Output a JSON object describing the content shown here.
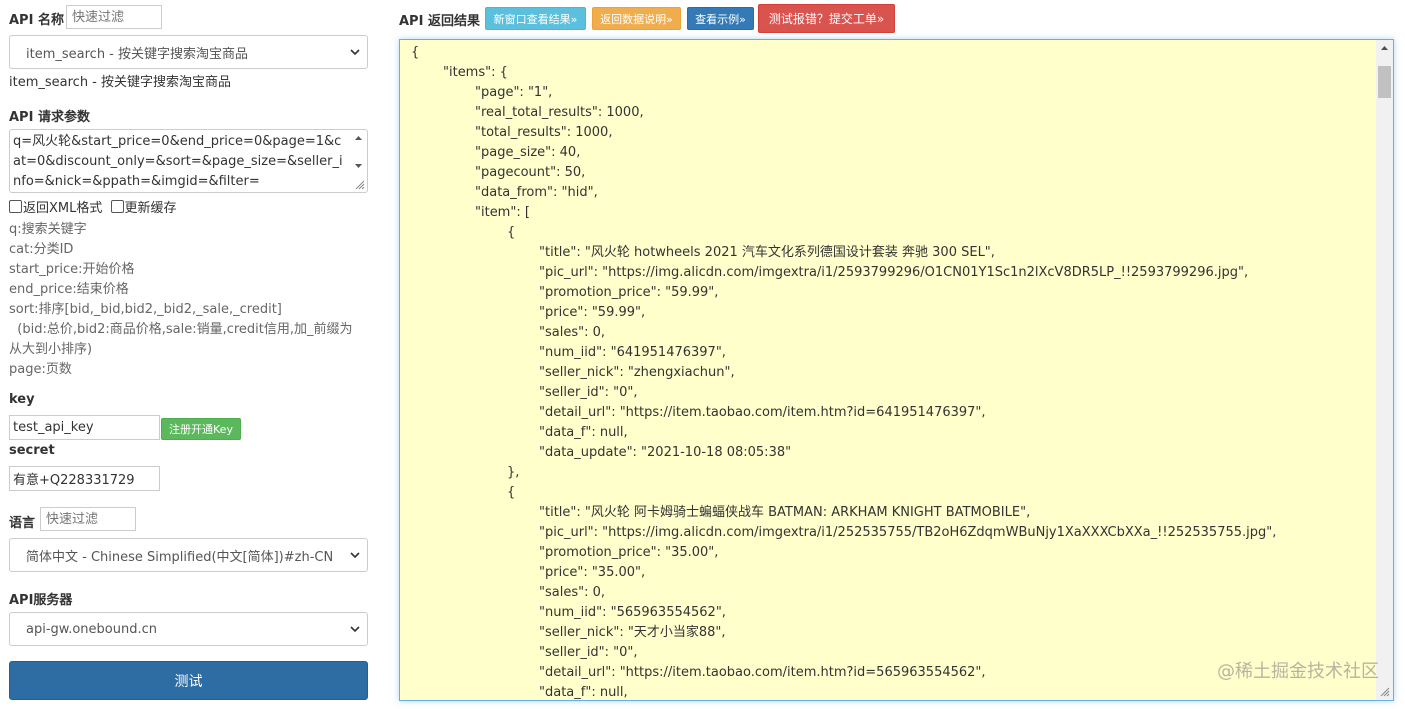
{
  "left": {
    "api_name_label": "API 名称",
    "api_name_filter_placeholder": "快速过滤",
    "api_select_value": "item_search - 按关键字搜索淘宝商品",
    "api_select_caption": "item_search - 按关键字搜索淘宝商品",
    "params_label": "API 请求参数",
    "params_value": "q=风火轮&start_price=0&end_price=0&page=1&cat=0&discount_only=&sort=&page_size=&seller_info=&nick=&ppath=&imgid=&filter=",
    "xml_checkbox_label": "返回XML格式",
    "cache_checkbox_label": "更新缓存",
    "hints": [
      "q:搜索关键字",
      "cat:分类ID",
      "start_price:开始价格",
      "end_price:结束价格",
      "sort:排序[bid,_bid,bid2,_bid2,_sale,_credit]",
      "  (bid:总价,bid2:商品价格,sale:销量,credit信用,加_前缀为",
      "从大到小排序)",
      "page:页数"
    ],
    "key_label": "key",
    "key_value": "test_api_key",
    "register_button": "注册开通Key",
    "secret_label": "secret",
    "secret_value": "有意+Q228331729",
    "lang_label": "语言",
    "lang_filter_placeholder": "快速过滤",
    "lang_select_value": "简体中文 - Chinese Simplified(中文[简体])#zh-CN",
    "server_label": "API服务器",
    "server_select_value": "api-gw.onebound.cn",
    "test_button": "测试"
  },
  "right": {
    "result_label": "API 返回结果",
    "buttons": [
      {
        "label": "新窗口查看结果»",
        "color": "#5bc0de"
      },
      {
        "label": "返回数据说明»",
        "color": "#f0ad4e"
      },
      {
        "label": "查看示例»",
        "color": "#337ab7"
      },
      {
        "label": "测试报错？提交工单»",
        "color": "#d9534f"
      }
    ],
    "json_lines": [
      "{",
      "\t\"items\": {",
      "\t\t\"page\": \"1\",",
      "\t\t\"real_total_results\": 1000,",
      "\t\t\"total_results\": 1000,",
      "\t\t\"page_size\": 40,",
      "\t\t\"pagecount\": 50,",
      "\t\t\"data_from\": \"hid\",",
      "\t\t\"item\": [",
      "\t\t\t{",
      "\t\t\t\t\"title\": \"风火轮 hotwheels 2021 汽车文化系列德国设计套装 奔驰 300 SEL\",",
      "\t\t\t\t\"pic_url\": \"https://img.alicdn.com/imgextra/i1/2593799296/O1CN01Y1Sc1n2lXcV8DR5LP_!!2593799296.jpg\",",
      "\t\t\t\t\"promotion_price\": \"59.99\",",
      "\t\t\t\t\"price\": \"59.99\",",
      "\t\t\t\t\"sales\": 0,",
      "\t\t\t\t\"num_iid\": \"641951476397\",",
      "\t\t\t\t\"seller_nick\": \"zhengxiachun\",",
      "\t\t\t\t\"seller_id\": \"0\",",
      "\t\t\t\t\"detail_url\": \"https://item.taobao.com/item.htm?id=641951476397\",",
      "\t\t\t\t\"data_f\": null,",
      "\t\t\t\t\"data_update\": \"2021-10-18 08:05:38\"",
      "\t\t\t},",
      "\t\t\t{",
      "\t\t\t\t\"title\": \"风火轮 阿卡姆骑士蝙蝠侠战车 BATMAN: ARKHAM KNIGHT BATMOBILE\",",
      "\t\t\t\t\"pic_url\": \"https://img.alicdn.com/imgextra/i1/252535755/TB2oH6ZdqmWBuNjy1XaXXXCbXXa_!!252535755.jpg\",",
      "\t\t\t\t\"promotion_price\": \"35.00\",",
      "\t\t\t\t\"price\": \"35.00\",",
      "\t\t\t\t\"sales\": 0,",
      "\t\t\t\t\"num_iid\": \"565963554562\",",
      "\t\t\t\t\"seller_nick\": \"天才小当家88\",",
      "\t\t\t\t\"seller_id\": \"0\",",
      "\t\t\t\t\"detail_url\": \"https://item.taobao.com/item.htm?id=565963554562\",",
      "\t\t\t\t\"data_f\": null,"
    ],
    "watermark": "@稀土掘金技术社区"
  }
}
